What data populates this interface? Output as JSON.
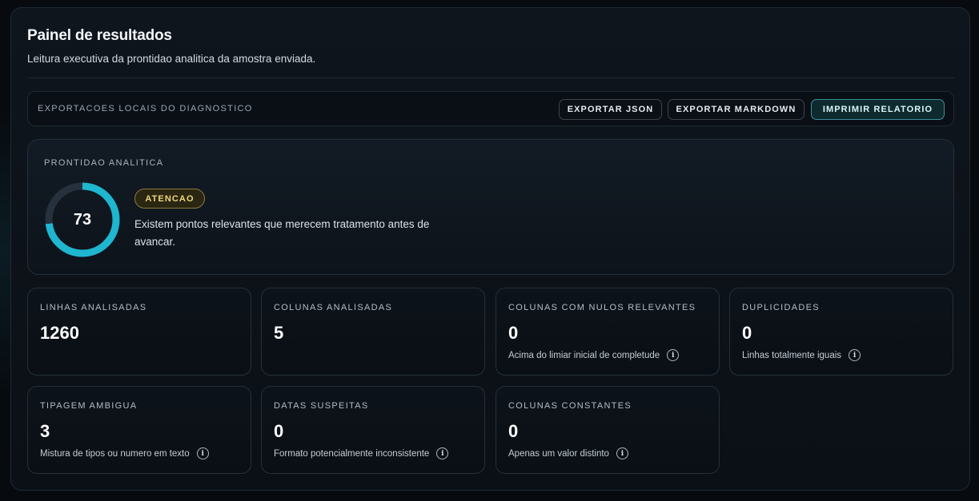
{
  "header": {
    "title": "Painel de resultados",
    "subtitle": "Leitura executiva da prontidao analitica da amostra enviada."
  },
  "exports": {
    "label": "EXPORTACOES LOCAIS DO DIAGNOSTICO",
    "buttons": {
      "json": "EXPORTAR JSON",
      "markdown": "EXPORTAR MARKDOWN",
      "print": "IMPRIMIR RELATORIO"
    }
  },
  "readiness": {
    "label": "PRONTIDAO ANALITICA",
    "score": 73,
    "score_max": 100,
    "status": "ATENCAO",
    "description": "Existem pontos relevantes que merecem tratamento antes de avancar.",
    "ring_color": "#1fb6cf",
    "track_color": "#27313d"
  },
  "metrics": [
    {
      "label": "LINHAS ANALISADAS",
      "value": "1260",
      "hint": ""
    },
    {
      "label": "COLUNAS ANALISADAS",
      "value": "5",
      "hint": ""
    },
    {
      "label": "COLUNAS COM NULOS RELEVANTES",
      "value": "0",
      "hint": "Acima do limiar inicial de completude",
      "icon": "info-icon"
    },
    {
      "label": "DUPLICIDADES",
      "value": "0",
      "hint": "Linhas totalmente iguais",
      "icon": "info-icon"
    },
    {
      "label": "TIPAGEM AMBIGUA",
      "value": "3",
      "hint": "Mistura de tipos ou numero em texto",
      "icon": "info-icon"
    },
    {
      "label": "DATAS SUSPEITAS",
      "value": "0",
      "hint": "Formato potencialmente inconsistente",
      "icon": "info-icon"
    },
    {
      "label": "COLUNAS CONSTANTES",
      "value": "0",
      "hint": "Apenas um valor distinto",
      "icon": "info-icon"
    }
  ],
  "icons": {
    "info": "i"
  }
}
